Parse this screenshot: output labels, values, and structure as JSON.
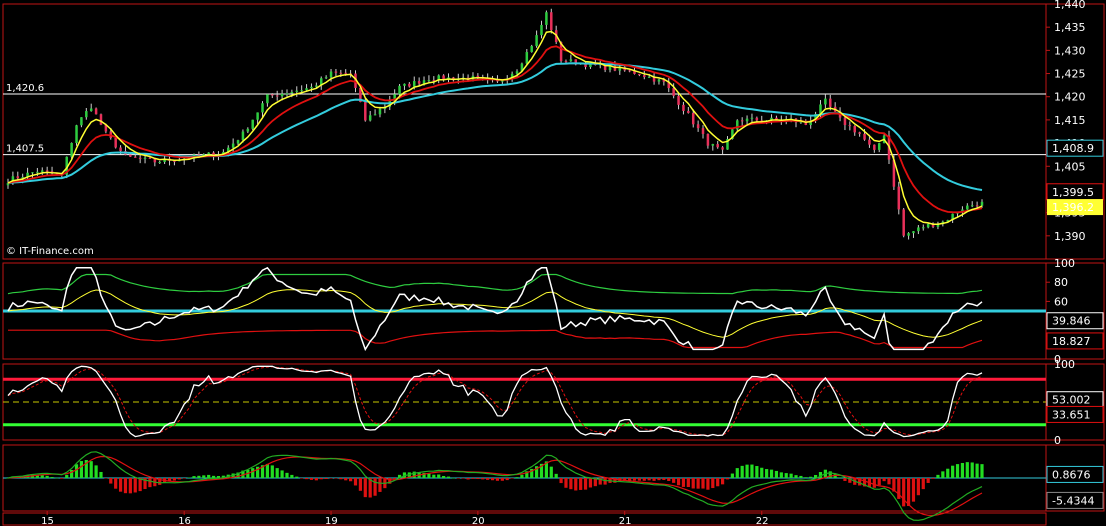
{
  "watermark": "© IT-Finance.com",
  "colors": {
    "background": "#000000",
    "frame": "#c01515",
    "up_candle": "#2ecc40",
    "down_candle": "#e8305a",
    "ma_fast": "#ffff33",
    "ma_mid": "#e01010",
    "ma_slow": "#33ccdd",
    "white": "#ffffff",
    "hist_pos": "#22dd22",
    "hist_neg": "#dd1111"
  },
  "chart_data": [
    {
      "type": "candlestick",
      "panel": "price",
      "ylim": [
        1385,
        1440
      ],
      "y_ticks": [
        "1,440",
        "1,435",
        "1,430",
        "1,425",
        "1,420",
        "1,415",
        "1,410",
        "1,405",
        "1,400",
        "1,395",
        "1,390"
      ],
      "y_tick_values": [
        1440,
        1435,
        1430,
        1425,
        1420,
        1415,
        1410,
        1405,
        1400,
        1395,
        1390
      ],
      "reference_levels": [
        {
          "label": "1,420.6",
          "value": 1420.6
        },
        {
          "label": "1,407.5",
          "value": 1407.5
        }
      ],
      "value_labels": [
        {
          "text": "1,408.9",
          "value": 1408.9,
          "color": "#33ccdd"
        },
        {
          "text": "1,399.5",
          "value": 1399.5,
          "color": "#e01010"
        },
        {
          "text": "1,396.2",
          "value": 1396.2,
          "color": "#ffff33"
        }
      ],
      "close_anchors": [
        [
          0,
          1402
        ],
        [
          6,
          1404
        ],
        [
          11,
          1403
        ],
        [
          14,
          1414
        ],
        [
          17,
          1418
        ],
        [
          20,
          1412
        ],
        [
          24,
          1407
        ],
        [
          30,
          1406
        ],
        [
          38,
          1407
        ],
        [
          44,
          1408
        ],
        [
          48,
          1412
        ],
        [
          53,
          1420
        ],
        [
          57,
          1421
        ],
        [
          62,
          1422
        ],
        [
          66,
          1425
        ],
        [
          70,
          1425
        ],
        [
          73,
          1415
        ],
        [
          77,
          1418
        ],
        [
          80,
          1422
        ],
        [
          86,
          1424
        ],
        [
          95,
          1424
        ],
        [
          100,
          1423
        ],
        [
          104,
          1426
        ],
        [
          108,
          1433
        ],
        [
          110,
          1438
        ],
        [
          113,
          1428
        ],
        [
          118,
          1427
        ],
        [
          124,
          1426
        ],
        [
          129,
          1425
        ],
        [
          134,
          1423
        ],
        [
          139,
          1416
        ],
        [
          143,
          1410
        ],
        [
          146,
          1408
        ],
        [
          149,
          1415
        ],
        [
          155,
          1415
        ],
        [
          160,
          1415
        ],
        [
          163,
          1414
        ],
        [
          167,
          1419
        ],
        [
          170,
          1415
        ],
        [
          174,
          1412
        ],
        [
          177,
          1408
        ],
        [
          179,
          1412
        ],
        [
          181,
          1401
        ],
        [
          183,
          1390
        ],
        [
          187,
          1392
        ],
        [
          191,
          1393
        ],
        [
          195,
          1396
        ],
        [
          198,
          1397
        ]
      ]
    },
    {
      "type": "line",
      "panel": "oscillator_1",
      "ylim": [
        0,
        100
      ],
      "y_ticks": [
        "100",
        "80",
        "60",
        "20",
        "0"
      ],
      "y_tick_values": [
        100,
        80,
        60,
        20,
        0
      ],
      "reference_level": 50,
      "value_labels": [
        {
          "text": "39.846",
          "value": 39.846
        },
        {
          "text": "18.827",
          "value": 18.827
        }
      ]
    },
    {
      "type": "line",
      "panel": "stochastic",
      "ylim": [
        0,
        100
      ],
      "y_ticks": [
        "100",
        "0"
      ],
      "y_tick_values": [
        100,
        0
      ],
      "bands": [
        80,
        20
      ],
      "mid_level": 50,
      "value_labels": [
        {
          "text": "53.002",
          "value": 53.002
        },
        {
          "text": "33.651",
          "value": 33.651
        }
      ]
    },
    {
      "type": "bar",
      "panel": "macd",
      "ylim": [
        -8,
        8
      ],
      "value_labels": [
        {
          "text": "0.8676",
          "value": 0.8676
        },
        {
          "text": "-5.4344",
          "value": -5.4344
        }
      ]
    }
  ],
  "x_axis": {
    "labels": [
      "15",
      "16",
      "19",
      "20",
      "21",
      "22"
    ],
    "label_bars": [
      8,
      36,
      66,
      96,
      126,
      154
    ]
  }
}
